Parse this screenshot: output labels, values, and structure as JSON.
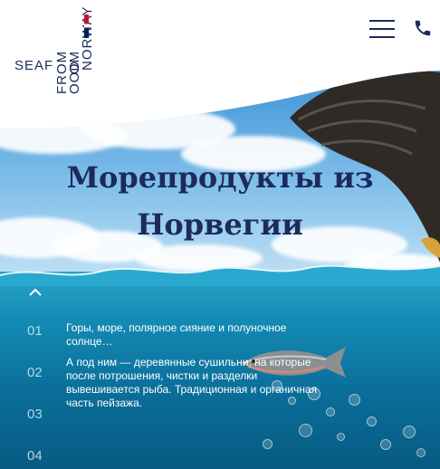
{
  "header": {
    "logo": {
      "seaf": "SEAF",
      "from": "FROM",
      "om": "OM",
      "norway": "NORWAY",
      "ood": "OOD"
    },
    "menu_icon": "hamburger-icon",
    "phone_icon": "phone-icon"
  },
  "hero": {
    "title_line1": "Морепродукты из",
    "title_line2": "Норвегии"
  },
  "slides": {
    "numbers": [
      "01",
      "02",
      "03",
      "04"
    ],
    "paragraphs": [
      "Горы, море, полярное сияние и полуночное солнце…",
      "А под ним — деревянные сушильни, на которые после потрошения, чистки и разделки вывешивается рыба. Традиционная и органичная часть пейзажа."
    ]
  },
  "colors": {
    "brand_navy": "#1c2a5c",
    "flag_red": "#c8102e",
    "sea_blue": "#0a6f9a"
  }
}
